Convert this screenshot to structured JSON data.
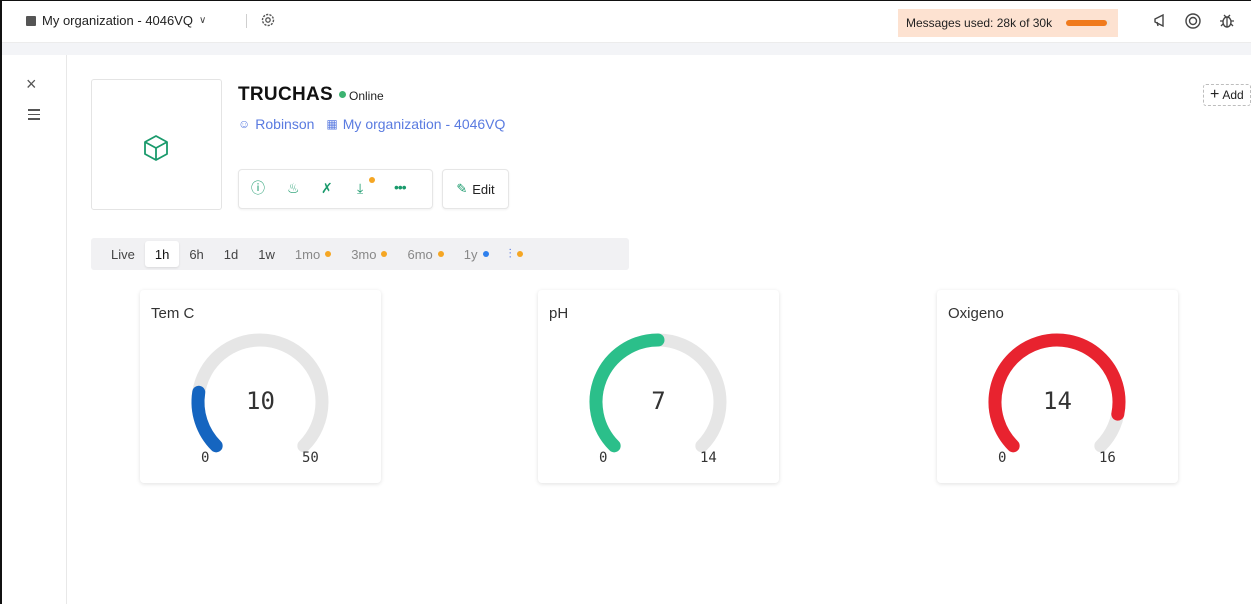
{
  "topbar": {
    "org_label": "My organization - 4046VQ",
    "chevron": "∨",
    "messages_label": "Messages used: 28k of 30k",
    "messages_used_fraction": 0.93,
    "icons": [
      "organization-icon",
      "gear-icon",
      "megaphone-icon",
      "help-ring-icon",
      "bug-icon"
    ]
  },
  "rail": {
    "close_glyph": "×"
  },
  "device": {
    "name": "TRUCHAS",
    "status": "Online",
    "status_color": "#3cb371",
    "owner": "Robinson",
    "organization": "My organization - 4046VQ",
    "edit_label": "Edit",
    "add_label": "Add",
    "accent": "#1a9a6c",
    "link_color": "#5a7be0"
  },
  "timerange": {
    "options": [
      {
        "label": "Live",
        "dot": null
      },
      {
        "label": "1h",
        "dot": null,
        "active": true
      },
      {
        "label": "6h",
        "dot": null
      },
      {
        "label": "1d",
        "dot": null
      },
      {
        "label": "1w",
        "dot": null
      },
      {
        "label": "1mo",
        "dot": "#f5a623"
      },
      {
        "label": "3mo",
        "dot": "#f5a623"
      },
      {
        "label": "6mo",
        "dot": "#f5a623"
      },
      {
        "label": "1y",
        "dot": "#2f80ed"
      },
      {
        "label": "custom-range-icon",
        "dot": "#f5a623"
      }
    ]
  },
  "gauges": [
    {
      "title": "Tem C",
      "value": 10,
      "min": 0,
      "max": 50,
      "color": "#1565c0"
    },
    {
      "title": "pH",
      "value": 7,
      "min": 0,
      "max": 14,
      "color": "#2bbf8a"
    },
    {
      "title": "Oxigeno",
      "value": 14,
      "min": 0,
      "max": 16,
      "color": "#e8232f"
    }
  ]
}
